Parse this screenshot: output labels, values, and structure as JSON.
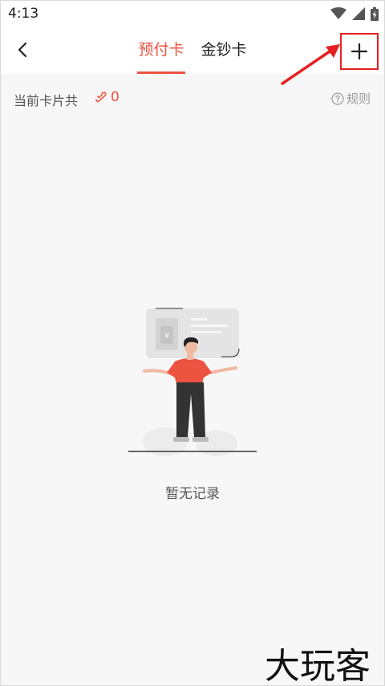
{
  "status_bar": {
    "time": "4:13",
    "icons": [
      "wifi-icon",
      "signal-icon",
      "battery-icon"
    ]
  },
  "nav": {
    "tabs": [
      {
        "label": "预付卡",
        "active": true
      },
      {
        "label": "金钞卡",
        "active": false
      }
    ],
    "add_icon": "plus-icon",
    "back_icon": "chevron-left-icon"
  },
  "info": {
    "label": "当前卡片共",
    "count": "0",
    "rules_label": "规则"
  },
  "empty_state": {
    "message": "暂无记录"
  },
  "watermark": {
    "text": "大玩客"
  },
  "colors": {
    "accent": "#ec5340",
    "annotation": "#e42020",
    "background": "#f7f7f7"
  }
}
